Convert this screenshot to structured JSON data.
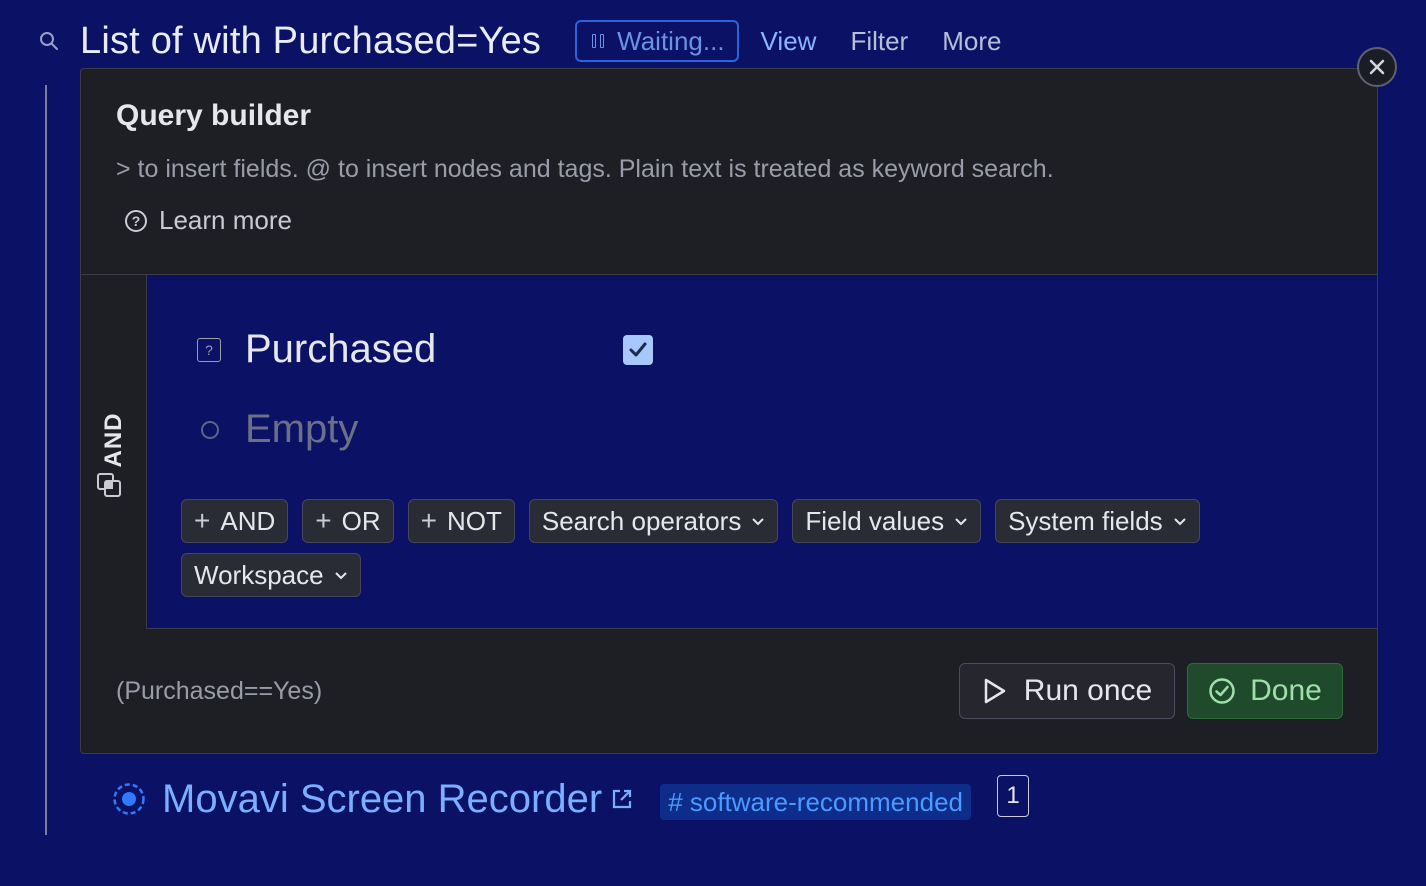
{
  "header": {
    "title": "List of with Purchased=Yes",
    "status": "Waiting...",
    "links": [
      "View",
      "Filter",
      "More"
    ]
  },
  "query_builder": {
    "title": "Query builder",
    "hint": "> to insert fields. @ to insert nodes and tags. Plain text is treated as keyword search.",
    "learn_more": "Learn more",
    "operator": "AND",
    "field": {
      "name": "Purchased",
      "checked": true
    },
    "empty_placeholder": "Empty",
    "add_buttons": [
      "AND",
      "OR",
      "NOT"
    ],
    "dropdowns": [
      "Search operators",
      "Field values",
      "System fields",
      "Workspace"
    ],
    "expression": "(Purchased==Yes)",
    "run_once": "Run once",
    "done": "Done"
  },
  "result": {
    "name": "Movavi Screen Recorder",
    "tag": "# software-recommended",
    "count": "1"
  },
  "colors": {
    "background": "#0b1266",
    "panel": "#1e1f24",
    "accent_blue": "#7aaeff",
    "done_green": "#9ee0a8"
  }
}
